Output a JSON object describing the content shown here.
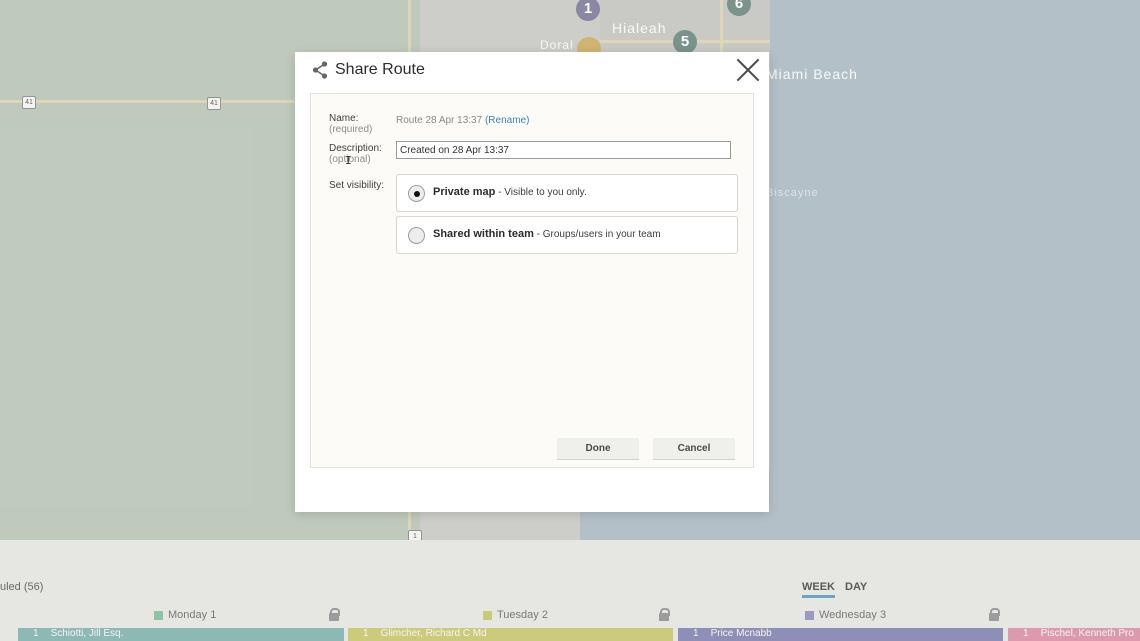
{
  "map": {
    "labels": {
      "hialeah": "Hialeah",
      "doral": "Doral",
      "miami_beach": "Miami Beach",
      "biscayne": "Biscayne"
    },
    "shields": [
      "41",
      "41",
      "1"
    ],
    "markers": [
      {
        "label": "1",
        "color": "#6f6d8f"
      },
      {
        "label": "5",
        "color": "#5d7c72"
      },
      {
        "label": "6",
        "color": "#5d7c72"
      },
      {
        "label": "",
        "color": "#c7a454"
      }
    ]
  },
  "dialog": {
    "title": "Share Route",
    "name_label": "Name:",
    "name_sub": "(required)",
    "name_value": "Route 28 Apr 13:37",
    "rename_link": "(Rename)",
    "description_label": "Description:",
    "description_sub": "(optional)",
    "description_value": "Created on 28 Apr 13:37",
    "visibility_label": "Set visibility:",
    "options": [
      {
        "title": "Private map",
        "desc": "- Visible to you only.",
        "checked": true
      },
      {
        "title": "Shared within team",
        "desc": "- Groups/users in your team",
        "checked": false
      }
    ],
    "done_button": "Done",
    "cancel_button": "Cancel"
  },
  "schedule": {
    "title": "uled (56)",
    "views": {
      "week": "WEEK",
      "day": "DAY",
      "active": "week"
    },
    "days": [
      {
        "label": "Monday 1",
        "color": "#8fc3a7",
        "bar_color": "#8db9b4",
        "entry_num": "1",
        "entry_name": "Schiotti, Jill Esq."
      },
      {
        "label": "Tuesday 2",
        "color": "#c9c97a",
        "bar_color": "#cccb7c",
        "entry_num": "1",
        "entry_name": "Glimcher, Richard C Md"
      },
      {
        "label": "Wednesday 3",
        "color": "#9a9ac2",
        "bar_color": "#8d8fb6",
        "entry_num": "1",
        "entry_name": "Price Mcnabb"
      },
      {
        "label": "",
        "color": "#e29ab0",
        "bar_color": "#dd9aae",
        "entry_num": "1",
        "entry_name": "Pischel, Kenneth Pro"
      }
    ]
  }
}
